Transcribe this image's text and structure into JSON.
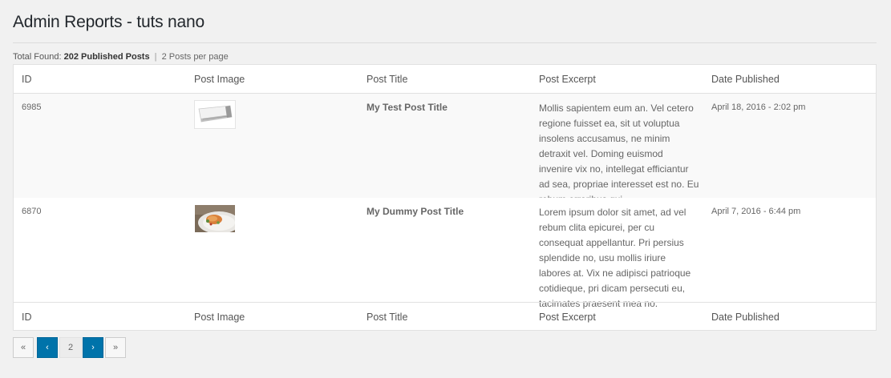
{
  "page": {
    "title": "Admin Reports - tuts nano"
  },
  "summary": {
    "total_found_label": "Total Found:",
    "total_found_value": "202 Published Posts",
    "separator": "|",
    "per_page": "2 Posts per page"
  },
  "table": {
    "columns": [
      "ID",
      "Post Image",
      "Post Title",
      "Post Excerpt",
      "Date Published"
    ],
    "rows": [
      {
        "id": "6985",
        "image_icon": "air-conditioner-thumbnail",
        "title": "My Test Post Title",
        "excerpt": "Mollis sapientem eum an. Vel cetero regione fuisset ea, sit ut voluptua insolens accusamus, ne minim detraxit vel. Doming euismod invenire vix no, intellegat efficiantur ad sea, propriae interesset est no. Eu rebum erroribus qui.",
        "date": "April 18, 2016 - 2:02 pm"
      },
      {
        "id": "6870",
        "image_icon": "food-plate-thumbnail",
        "title": "My Dummy Post Title",
        "excerpt": "Lorem ipsum dolor sit amet, ad vel rebum clita epicurei, per cu consequat appellantur. Pri persius splendide no, usu mollis iriure labores at. Vix ne adipisci patrioque cotidieque, pri dicam persecuti eu, tacimates praesent mea no.",
        "date": "April 7, 2016 - 6:44 pm"
      }
    ]
  },
  "pagination": {
    "first": "«",
    "prev": "‹",
    "current": "2",
    "next": "›",
    "last": "»"
  },
  "colors": {
    "link": "#21759b",
    "pager_active": "#0073aa"
  }
}
